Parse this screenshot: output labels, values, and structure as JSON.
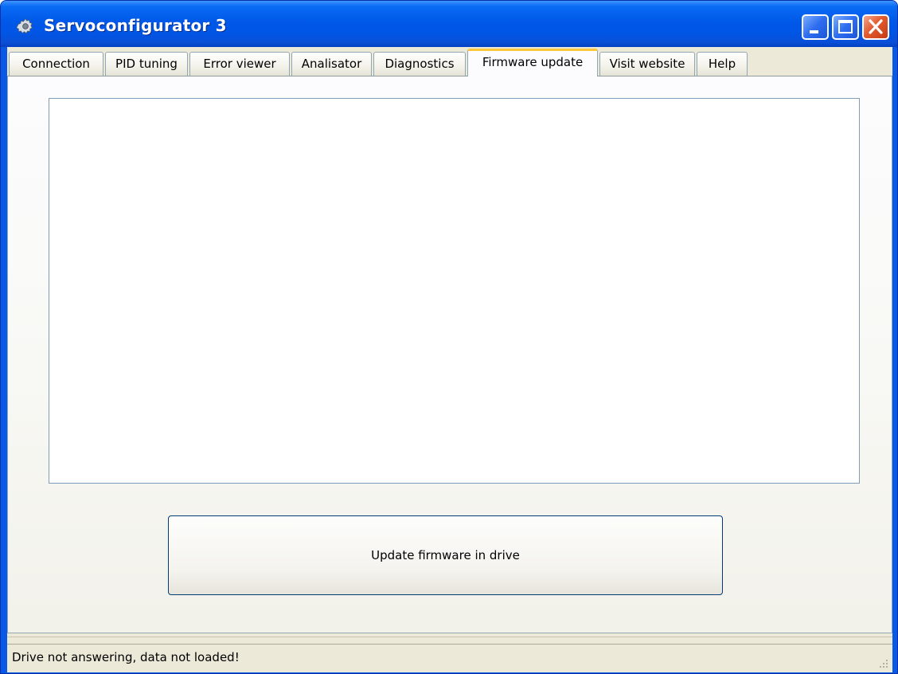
{
  "window": {
    "title": "Servoconfigurator 3",
    "app_icon": "gear-icon",
    "controls": {
      "minimize": "minimize-icon",
      "maximize": "maximize-icon",
      "close": "close-icon"
    }
  },
  "tabs": [
    {
      "label": "Connection",
      "active": false
    },
    {
      "label": "PID tuning",
      "active": false
    },
    {
      "label": "Error viewer",
      "active": false
    },
    {
      "label": "Analisator",
      "active": false
    },
    {
      "label": "Diagnostics",
      "active": false
    },
    {
      "label": "Firmware update",
      "active": true
    },
    {
      "label": "Visit website",
      "active": false
    },
    {
      "label": "Help",
      "active": false
    }
  ],
  "firmware_page": {
    "log_text": "",
    "update_button_label": "Update firmware in drive"
  },
  "status_bar": {
    "message": "Drive not answering, data not loaded!"
  },
  "colors": {
    "titlebar": "#0055e5",
    "active_tab_highlight": "#ffc83c",
    "close_button": "#e25a2e",
    "face": "#ece9d8"
  }
}
